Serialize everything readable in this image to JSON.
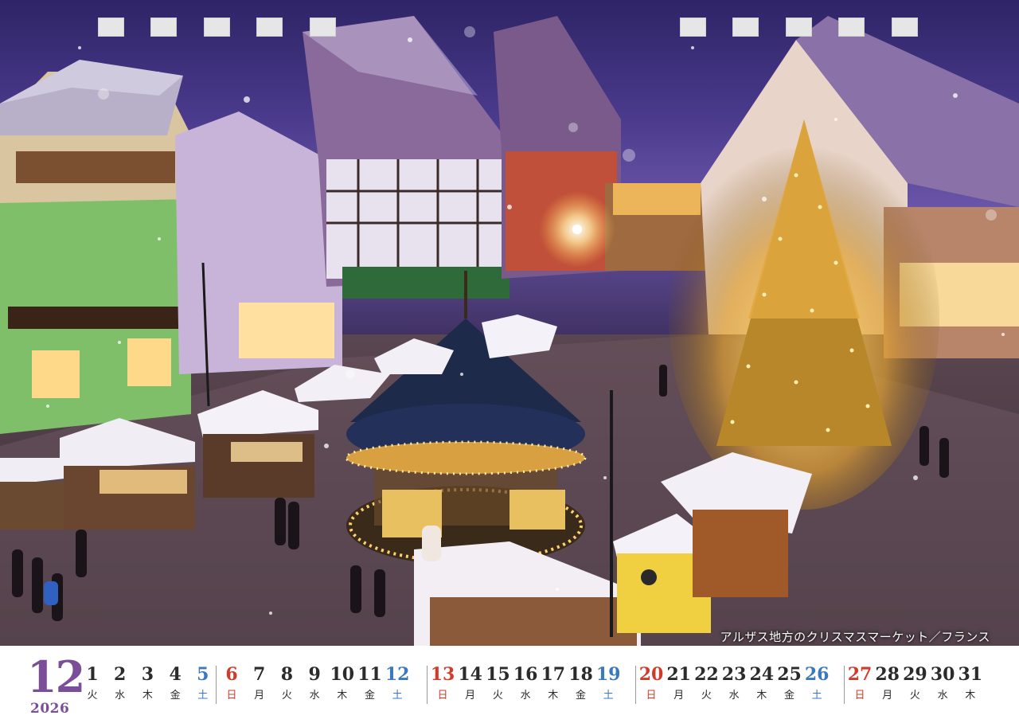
{
  "photo": {
    "caption": "アルザス地方のクリスマスマーケット／フランス"
  },
  "calendar": {
    "month": "12",
    "year": "2026",
    "days": [
      {
        "n": "1",
        "w": "火",
        "t": "weekday"
      },
      {
        "n": "2",
        "w": "水",
        "t": "weekday"
      },
      {
        "n": "3",
        "w": "木",
        "t": "weekday"
      },
      {
        "n": "4",
        "w": "金",
        "t": "weekday"
      },
      {
        "n": "5",
        "w": "土",
        "t": "sat"
      },
      {
        "n": "6",
        "w": "日",
        "t": "sun"
      },
      {
        "n": "7",
        "w": "月",
        "t": "weekday"
      },
      {
        "n": "8",
        "w": "火",
        "t": "weekday"
      },
      {
        "n": "9",
        "w": "水",
        "t": "weekday"
      },
      {
        "n": "10",
        "w": "木",
        "t": "weekday"
      },
      {
        "n": "11",
        "w": "金",
        "t": "weekday"
      },
      {
        "n": "12",
        "w": "土",
        "t": "sat"
      },
      {
        "n": "13",
        "w": "日",
        "t": "sun"
      },
      {
        "n": "14",
        "w": "月",
        "t": "weekday"
      },
      {
        "n": "15",
        "w": "火",
        "t": "weekday"
      },
      {
        "n": "16",
        "w": "水",
        "t": "weekday"
      },
      {
        "n": "17",
        "w": "木",
        "t": "weekday"
      },
      {
        "n": "18",
        "w": "金",
        "t": "weekday"
      },
      {
        "n": "19",
        "w": "土",
        "t": "sat"
      },
      {
        "n": "20",
        "w": "日",
        "t": "sun"
      },
      {
        "n": "21",
        "w": "月",
        "t": "weekday"
      },
      {
        "n": "22",
        "w": "火",
        "t": "weekday"
      },
      {
        "n": "23",
        "w": "水",
        "t": "weekday"
      },
      {
        "n": "24",
        "w": "木",
        "t": "weekday"
      },
      {
        "n": "25",
        "w": "金",
        "t": "weekday"
      },
      {
        "n": "26",
        "w": "土",
        "t": "sat"
      },
      {
        "n": "27",
        "w": "日",
        "t": "sun"
      },
      {
        "n": "28",
        "w": "月",
        "t": "weekday"
      },
      {
        "n": "29",
        "w": "火",
        "t": "weekday"
      },
      {
        "n": "30",
        "w": "水",
        "t": "weekday"
      },
      {
        "n": "31",
        "w": "木",
        "t": "weekday"
      }
    ]
  },
  "colors": {
    "month_purple": "#7a4e98",
    "saturday_blue": "#3a78c0",
    "sunday_red": "#d23a2a"
  }
}
